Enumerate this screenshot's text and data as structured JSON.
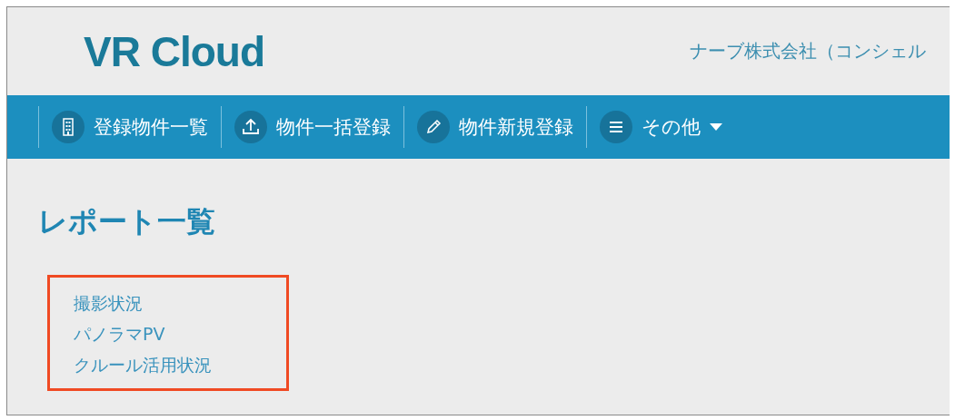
{
  "header": {
    "logo": "VR Cloud",
    "company": "ナーブ株式会社（コンシェル"
  },
  "nav": [
    {
      "label": "登録物件一覧",
      "kind": "building",
      "dropdown": false
    },
    {
      "label": "物件一括登録",
      "kind": "upload",
      "dropdown": false
    },
    {
      "label": "物件新規登録",
      "kind": "pencil",
      "dropdown": false
    },
    {
      "label": "その他",
      "kind": "menu",
      "dropdown": true
    }
  ],
  "page_title": "レポート一覧",
  "reports": {
    "highlighted": true,
    "links": [
      "撮影状況",
      "パノラマPV",
      "クルール活用状況"
    ]
  }
}
